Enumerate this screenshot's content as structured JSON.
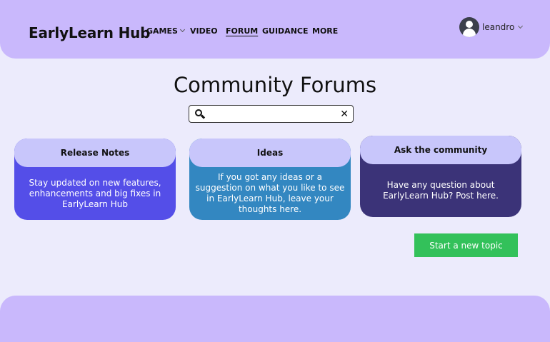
{
  "header": {
    "logo": "EarlyLearn Hub",
    "nav": [
      {
        "label": "GAMES",
        "has_dropdown": true
      },
      {
        "label": "VIDEO"
      },
      {
        "label": "FORUM",
        "active": true
      },
      {
        "label": "GUIDANCE"
      },
      {
        "label": "MORE"
      }
    ],
    "user": {
      "name": "leandro"
    }
  },
  "main": {
    "title": "Community Forums",
    "search": {
      "value": "",
      "placeholder": ""
    },
    "cards": [
      {
        "title": "Release Notes",
        "body": "Stay updated on new features, enhancements and big fixes in EarlyLearn Hub"
      },
      {
        "title": "Ideas",
        "body": "If you got any ideas or a suggestion on what you like to see in EarlyLearn Hub, leave your thoughts here."
      },
      {
        "title": "Ask the community",
        "body": "Have any question about EarlyLearn Hub? Post here."
      }
    ],
    "cta_label": "Start a new topic"
  },
  "colors": {
    "header": "#c9b8fc",
    "background": "#ecebfc",
    "card_release": "#544ee8",
    "card_ideas": "#3387c1",
    "card_ask": "#3b3378",
    "cta": "#33c15a"
  }
}
